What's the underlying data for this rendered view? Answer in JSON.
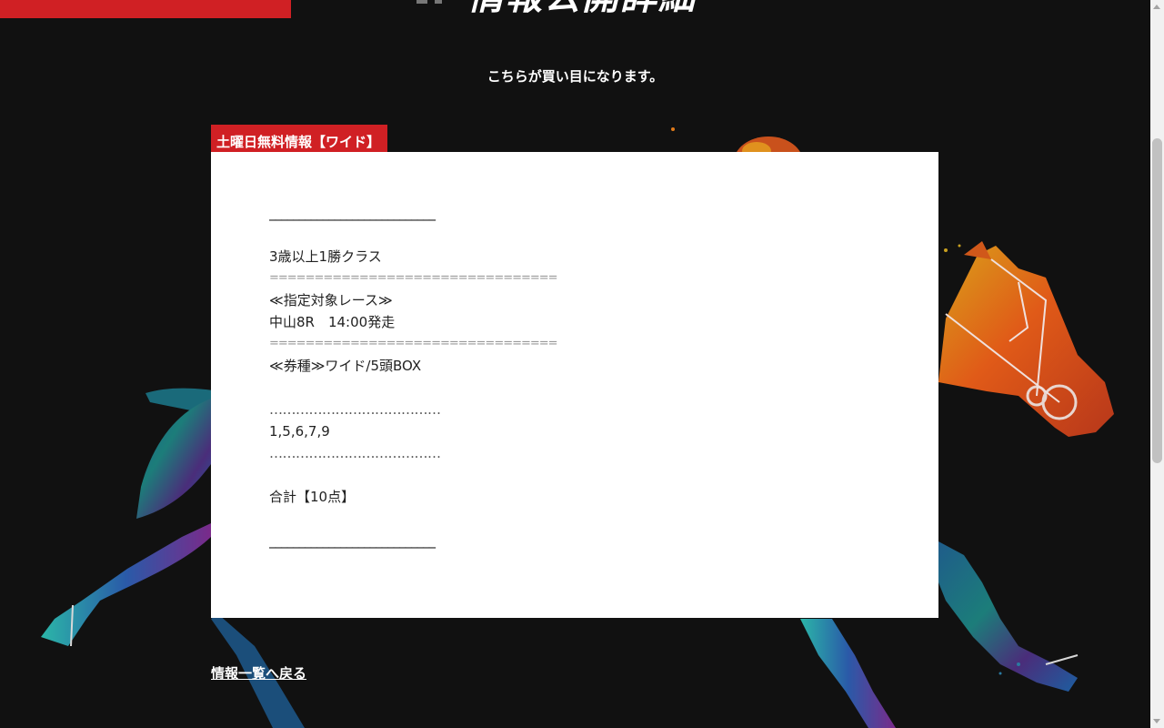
{
  "page": {
    "heading": "情報公開詳細",
    "intro": "こちらが買い目になります。"
  },
  "post": {
    "category": "土曜日無料情報【ワイド】",
    "lines": {
      "rule_top": "____________________________",
      "race_class": "3歳以上1勝クラス",
      "separator_1": "================================",
      "target_label": "≪指定対象レース≫",
      "race_info": "中山8R　14:00発走",
      "separator_2": "================================",
      "bet_type": "≪券種≫ワイド/5頭BOX",
      "dots_1": "…………………………………",
      "numbers": "1,5,6,7,9",
      "dots_2": "…………………………………",
      "total": "合計【10点】",
      "rule_bottom": "____________________________"
    }
  },
  "nav": {
    "back_link": "情報一覧へ戻る"
  },
  "colors": {
    "background": "#111111",
    "accent_red": "#d02024",
    "card": "#ffffff"
  }
}
